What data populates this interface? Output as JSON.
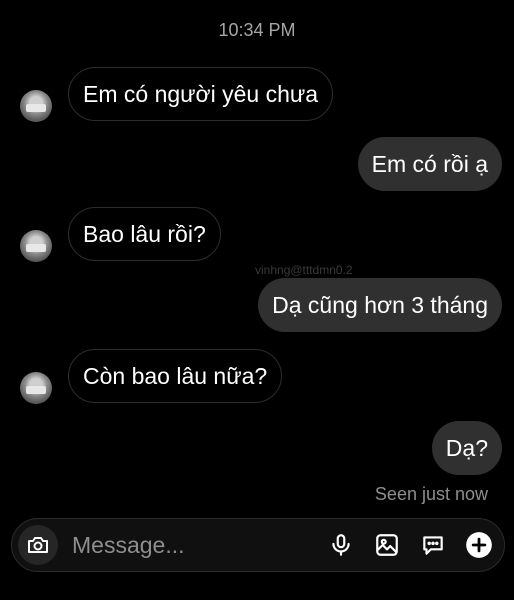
{
  "header": {
    "timestamp": "10:34 PM"
  },
  "watermark": "vinhng@tttdmn0.2",
  "messages": [
    {
      "sender": "them",
      "text": "Em có người yêu chưa"
    },
    {
      "sender": "me",
      "text": "Em có rồi ạ"
    },
    {
      "sender": "them",
      "text": "Bao lâu rồi?"
    },
    {
      "sender": "me",
      "text": "Dạ cũng hơn 3 tháng"
    },
    {
      "sender": "them",
      "text": "Còn bao lâu nữa?"
    },
    {
      "sender": "me",
      "text": "Dạ?"
    }
  ],
  "status": {
    "seen": "Seen just now"
  },
  "composer": {
    "placeholder": "Message...",
    "icons": [
      "camera-icon",
      "microphone-icon",
      "gallery-icon",
      "sticker-icon",
      "plus-icon"
    ]
  },
  "colors": {
    "background": "#000000",
    "sent_bubble": "#303030",
    "received_border": "#2d2d2d"
  }
}
